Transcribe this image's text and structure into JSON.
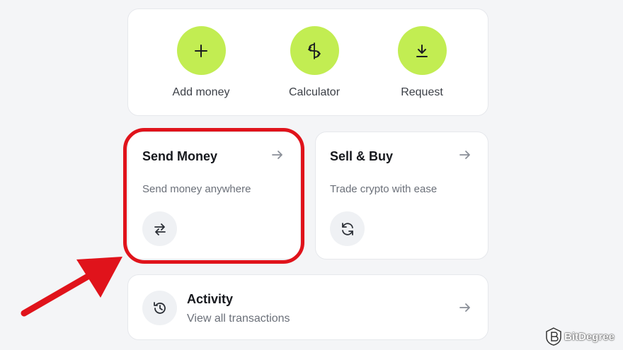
{
  "colors": {
    "accent": "#c2ed52",
    "highlight": "#e0131b",
    "text_primary": "#16181d",
    "text_secondary": "#6b7079"
  },
  "quick_actions": [
    {
      "label": "Add money",
      "icon": "plus-icon"
    },
    {
      "label": "Calculator",
      "icon": "calculator-icon"
    },
    {
      "label": "Request",
      "icon": "download-icon"
    }
  ],
  "tiles": {
    "send": {
      "title": "Send Money",
      "subtitle": "Send money anywhere",
      "icon": "transfer-arrows-icon"
    },
    "sell_buy": {
      "title": "Sell & Buy",
      "subtitle": "Trade crypto with ease",
      "icon": "refresh-icon"
    }
  },
  "activity": {
    "title": "Activity",
    "subtitle": "View all transactions",
    "icon": "history-icon"
  },
  "watermark": {
    "text": "BitDegree"
  }
}
